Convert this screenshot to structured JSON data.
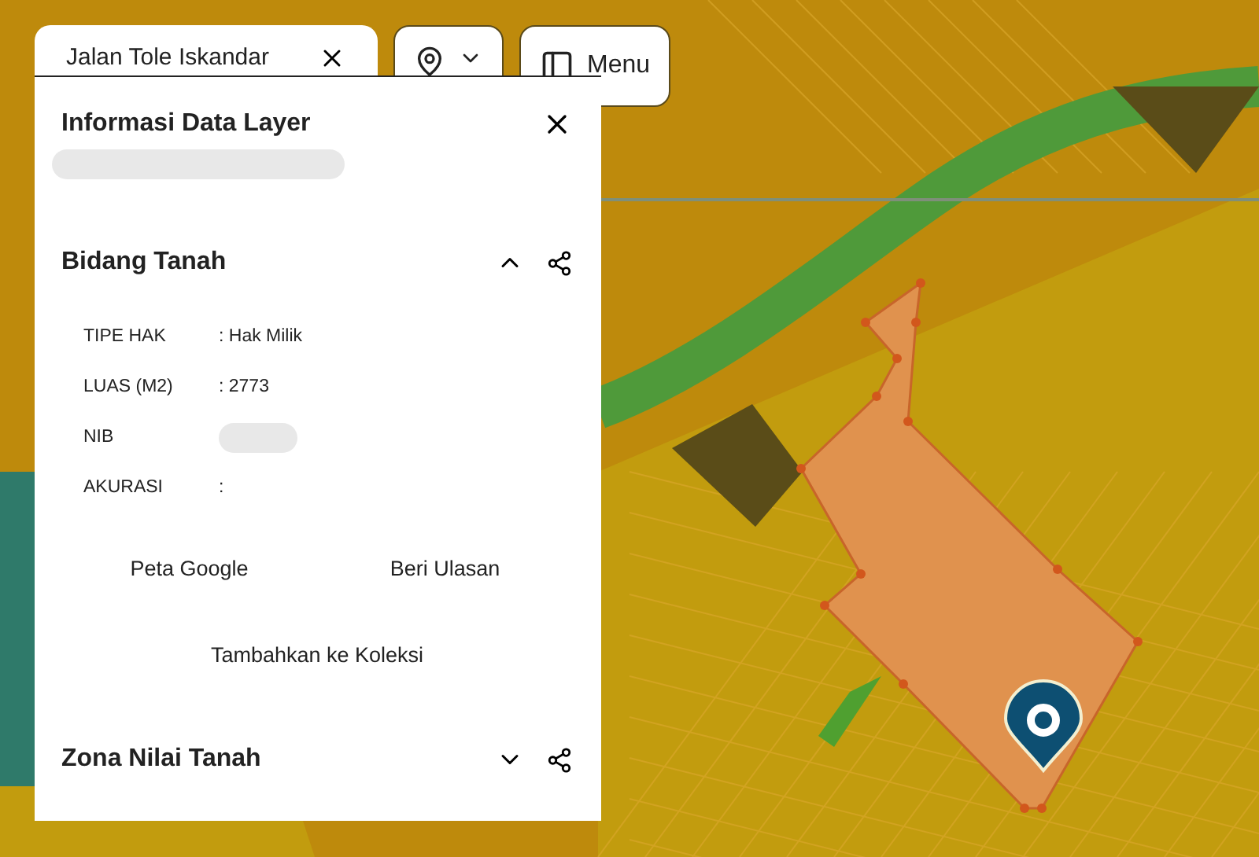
{
  "search": {
    "value": "Jalan Tole Iskandar"
  },
  "menu_button": {
    "label": "Menu"
  },
  "panel": {
    "title": "Informasi Data Layer",
    "subtitle_redacted": true,
    "sections": [
      {
        "title": "Bidang Tanah",
        "expanded": true,
        "fields": [
          {
            "label": "TIPE HAK",
            "value": ": Hak Milik",
            "redacted": false
          },
          {
            "label": "LUAS (M2)",
            "value": ": 2773",
            "redacted": false
          },
          {
            "label": "NIB",
            "redacted": true
          },
          {
            "label": "AKURASI",
            "value": ":",
            "redacted": false
          }
        ],
        "actions": [
          "Peta Google",
          "Beri Ulasan",
          "Tambahkan ke Koleksi"
        ]
      },
      {
        "title": "Zona Nilai Tanah",
        "expanded": false
      }
    ]
  }
}
